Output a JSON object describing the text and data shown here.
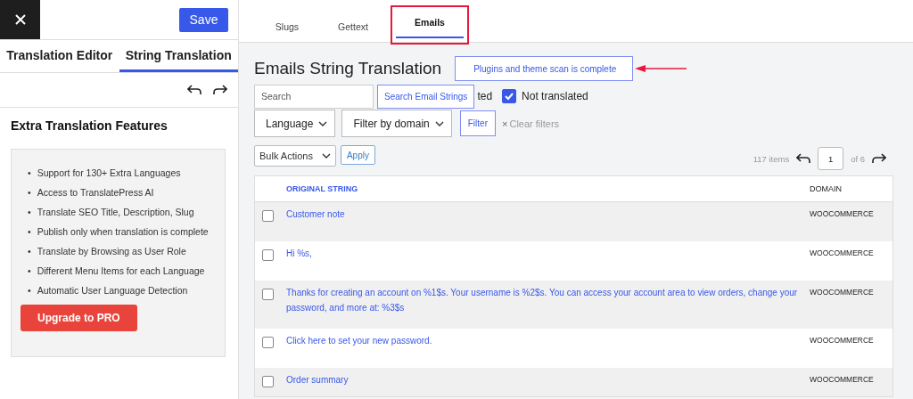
{
  "top_bar": {
    "save_button": "Save"
  },
  "editor_tabs": [
    {
      "label": "Translation Editor",
      "selected": false
    },
    {
      "label": "String Translation",
      "selected": true
    }
  ],
  "features": {
    "title": "Extra Translation Features",
    "items": [
      {
        "marker": "•",
        "text": "Support for 130+ Extra Languages"
      },
      {
        "marker": "•",
        "text": "Access to TranslatePress AI"
      },
      {
        "marker": "•",
        "text": "Translate SEO Title, Description, Slug"
      },
      {
        "marker": "•",
        "text": "Publish only when translation is complete"
      },
      {
        "marker": "•",
        "text": "Translate by Browsing as User Role"
      },
      {
        "marker": "•",
        "text": "Different Menu Items for each Language"
      },
      {
        "marker": "•",
        "text": "Automatic User Language Detection"
      }
    ],
    "upgrade_button": "Upgrade to PRO"
  },
  "string_tabs": [
    {
      "label": "Slugs",
      "selected": false,
      "highlighted": false
    },
    {
      "label": "Gettext",
      "selected": false,
      "highlighted": false
    },
    {
      "label": "Emails",
      "selected": true,
      "highlighted": true
    }
  ],
  "heading": "Emails String Translation",
  "notice": "Plugins and theme scan is complete",
  "search": {
    "placeholder": "Search",
    "button": "Search Email Strings"
  },
  "partial_filter_label": "ted",
  "not_translated": {
    "label": "Not translated",
    "checked": true
  },
  "filters": {
    "language": "Language",
    "domain": "Filter by domain",
    "filter_button": "Filter",
    "clear_icon": "×",
    "clear": "Clear filters"
  },
  "bulk": {
    "select": "Bulk Actions",
    "apply": "Apply"
  },
  "pagination": {
    "count": "117 items",
    "page": "1",
    "of": "of 6"
  },
  "table": {
    "columns": [
      "ORIGINAL STRING",
      "DOMAIN"
    ],
    "rows": [
      {
        "original": "Customer note",
        "domain": "WOOCOMMERCE",
        "checked": false
      },
      {
        "original": "Hi %s,",
        "domain": "WOOCOMMERCE",
        "checked": false
      },
      {
        "original": "Thanks for creating an account on %1$s. Your username is %2$s. You can access your account area to view orders, change your password, and more at: %3$s",
        "domain": "WOOCOMMERCE",
        "checked": false
      },
      {
        "original": "Click here to set your new password.",
        "domain": "WOOCOMMERCE",
        "checked": false
      },
      {
        "original": "Order summary",
        "domain": "WOOCOMMERCE",
        "checked": false
      }
    ]
  }
}
